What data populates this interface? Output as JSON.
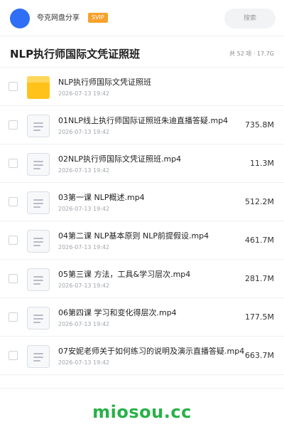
{
  "header": {
    "brand": "夸克网盘分享",
    "badge": "SVIP",
    "search_placeholder": "搜索"
  },
  "share": {
    "title": "NLP执行师国际文凭证照班",
    "summary": "共 52 项 · 17.7G"
  },
  "files": [
    {
      "type": "folder",
      "icon": "folder-icon",
      "name": "NLP执行师国际文凭证照班",
      "date": "2026-07-13 19:42",
      "size": ""
    },
    {
      "type": "file",
      "icon": "document-icon",
      "name": "01NLP线上执行师国际证照班朱迪直播答疑.mp4",
      "date": "2026-07-13 19:42",
      "size": "735.8M"
    },
    {
      "type": "file",
      "icon": "document-icon",
      "name": "02NLP执行师国际文凭证照班.mp4",
      "date": "2026-07-13 19:42",
      "size": "11.3M"
    },
    {
      "type": "file",
      "icon": "document-icon",
      "name": "03第一课 NLP概述.mp4",
      "date": "2026-07-13 19:42",
      "size": "512.2M"
    },
    {
      "type": "file",
      "icon": "document-icon",
      "name": "04第二课 NLP基本原则 NLP前提假设.mp4",
      "date": "2026-07-13 19:42",
      "size": "461.7M"
    },
    {
      "type": "file",
      "icon": "document-icon",
      "name": "05第三课 方法，工具&学习层次.mp4",
      "date": "2026-07-13 19:42",
      "size": "281.7M"
    },
    {
      "type": "file",
      "icon": "document-icon",
      "name": "06第四课 学习和变化得层次.mp4",
      "date": "2026-07-13 19:42",
      "size": "177.5M"
    },
    {
      "type": "file",
      "icon": "document-icon",
      "name": "07安妮老师关于如何练习的说明及演示直播答疑.mp4",
      "date": "2026-07-13 19:42",
      "size": "663.7M"
    }
  ],
  "watermark": "miosou.cc",
  "colors": {
    "accent": "#2f6ef6",
    "vip": "#f7a22c",
    "folder": "#ffc21a",
    "watermark": "#28b148"
  }
}
